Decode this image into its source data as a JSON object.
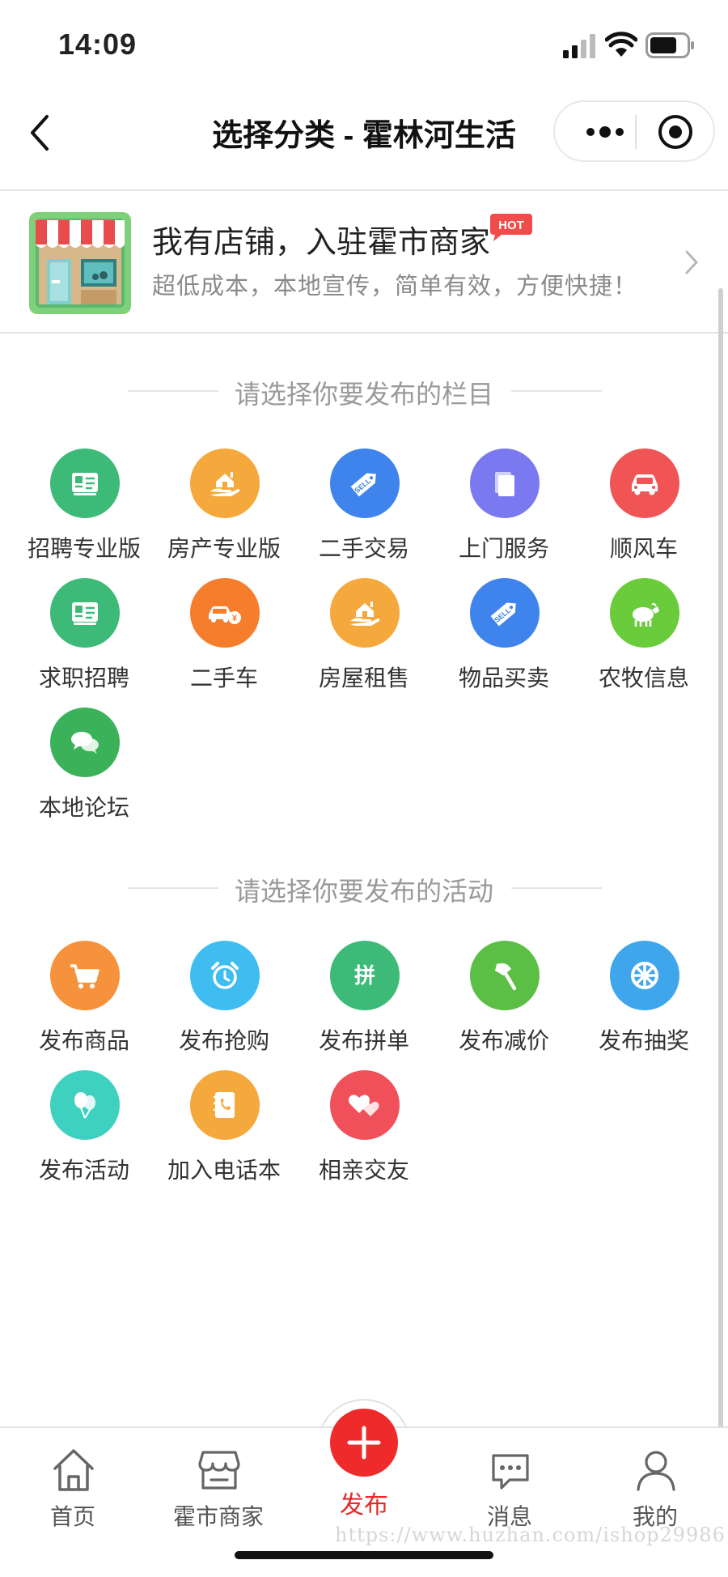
{
  "status": {
    "time": "14:09"
  },
  "nav": {
    "title": "选择分类 - 霍林河生活"
  },
  "shop": {
    "headline": "我有店铺，入驻霍市商家",
    "badge": "HOT",
    "subtitle": "超低成本，本地宣传，简单有效，方便快捷！"
  },
  "sections": {
    "columns_title": "请选择你要发布的栏目",
    "activities_title": "请选择你要发布的活动"
  },
  "columns": [
    {
      "label": "招聘专业版",
      "icon": "id-card-icon",
      "color": "#3dba78"
    },
    {
      "label": "房产专业版",
      "icon": "house-hand-icon",
      "color": "#f5a83b"
    },
    {
      "label": "二手交易",
      "icon": "sell-tag-icon",
      "color": "#3f84ec"
    },
    {
      "label": "上门服务",
      "icon": "cards-icon",
      "color": "#7b79f0"
    },
    {
      "label": "顺风车",
      "icon": "car-icon",
      "color": "#f05454"
    },
    {
      "label": "求职招聘",
      "icon": "id-card-icon",
      "color": "#3dba78"
    },
    {
      "label": "二手车",
      "icon": "used-car-icon",
      "color": "#f57d2c"
    },
    {
      "label": "房屋租售",
      "icon": "house-hand-icon",
      "color": "#f5a83b"
    },
    {
      "label": "物品买卖",
      "icon": "sell-tag-icon",
      "color": "#3f84ec"
    },
    {
      "label": "农牧信息",
      "icon": "sheep-icon",
      "color": "#6acb3b"
    },
    {
      "label": "本地论坛",
      "icon": "chat-bubbles-icon",
      "color": "#3bb25a"
    }
  ],
  "activities": [
    {
      "label": "发布商品",
      "icon": "cart-icon",
      "color": "#f5923b"
    },
    {
      "label": "发布抢购",
      "icon": "alarm-clock-icon",
      "color": "#3fbdf0"
    },
    {
      "label": "发布拼单",
      "icon": "pin-char-icon",
      "color": "#3dba78",
      "glyph": "拼"
    },
    {
      "label": "发布减价",
      "icon": "axe-icon",
      "color": "#5cbf45"
    },
    {
      "label": "发布抽奖",
      "icon": "wheel-icon",
      "color": "#3fa6ec"
    },
    {
      "label": "发布活动",
      "icon": "balloons-icon",
      "color": "#3fd1c0"
    },
    {
      "label": "加入电话本",
      "icon": "phonebook-icon",
      "color": "#f5a83b"
    },
    {
      "label": "相亲交友",
      "icon": "hearts-icon",
      "color": "#f0505a"
    }
  ],
  "tabbar": {
    "home": "首页",
    "merchants": "霍市商家",
    "publish": "发布",
    "messages": "消息",
    "mine": "我的"
  },
  "watermark": "https://www.huzhan.com/ishop29986",
  "colors": {
    "accent": "#e62a2a"
  }
}
